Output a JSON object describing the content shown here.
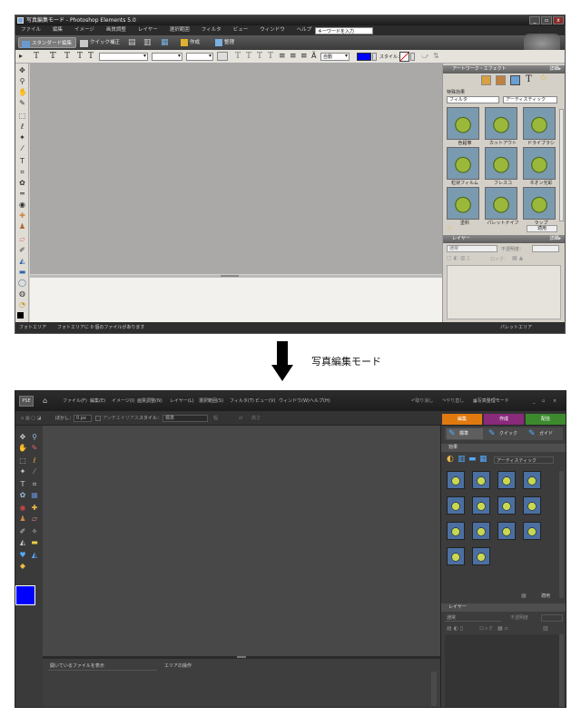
{
  "top": {
    "title": "写真編集モード - Photoshop Elements 5.0",
    "win_buttons": [
      "_",
      "▫",
      "x"
    ],
    "menu": [
      "ファイル",
      "編集",
      "イメージ",
      "画質調整",
      "レイヤー",
      "選択範囲",
      "フィルタ",
      "ビュー",
      "ウィンドウ",
      "ヘルプ"
    ],
    "keyword_placeholder": "キーワードを入力",
    "modes": [
      {
        "label": "スタンダード編集",
        "active": true
      },
      {
        "label": "クイック補正",
        "active": false
      }
    ],
    "create_label": "作成",
    "organize_label": "整理",
    "text_options": {
      "auto_label": "自動",
      "style_label": "スタイル：",
      "color": "#0000ff"
    },
    "artwork_panel": {
      "title": "アートワーク・エフェクト",
      "more": "詳細▸",
      "section": "特殊効果",
      "filter_select": "フィルタ",
      "category_select": "アーティスティック",
      "thumbs": [
        "色鉛筆",
        "カットアウト",
        "ドライブラシ",
        "粒状フィルム",
        "フレスコ",
        "ネオン光彩",
        "塗料",
        "パレットナイフ",
        "ラップ"
      ],
      "apply": "適用"
    },
    "layers_panel": {
      "title": "レイヤー",
      "more": "詳細▸",
      "blend": "通常",
      "opacity_label": "不透明度：",
      "lock_label": "ロック："
    },
    "status_left": "フォトエリア",
    "status_msg": "フォトエリアに 0 個のファイルがあります",
    "status_right": "パレットエリア"
  },
  "caption": "写真編集モード",
  "bot": {
    "menu": [
      "ファイル(F)",
      "編集(E)",
      "イメージ(I)",
      "画質調整(N)",
      "レイヤー(L)",
      "選択範囲(S)",
      "フィルタ(T)",
      "ビュー(V)",
      "ウィンドウ(W)",
      "ヘルプ(H)"
    ],
    "undo": "取り消し",
    "redo": "やり直し",
    "organizer": "写真整理モード",
    "win_buttons": [
      "_",
      "▫",
      "×"
    ],
    "options": {
      "feather_label": "ぼかし：",
      "feather_value": "0 px",
      "antialias": "アンチエイリアス",
      "style_label": "スタイル：",
      "style_value": "標準",
      "width_label": "幅",
      "height_label": "高さ"
    },
    "tabs": [
      {
        "label": "編集",
        "color": "#e07a10"
      },
      {
        "label": "作成",
        "color": "#8a2a7a"
      },
      {
        "label": "配信",
        "color": "#3d8a2e"
      }
    ],
    "mode_buttons": [
      "標準",
      "クイック",
      "ガイド"
    ],
    "effects_panel": {
      "title": "効果",
      "select": "アーティスティック",
      "apply": "適用"
    },
    "layers_panel": {
      "title": "レイヤー",
      "blend": "通常",
      "opacity_label": "不透明度",
      "lock_label": "ロック"
    },
    "bin_select": "開いているファイルを表示",
    "bin_action": "エリアの操作"
  }
}
